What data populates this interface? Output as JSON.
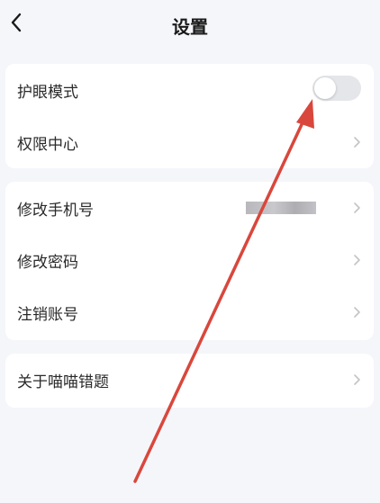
{
  "header": {
    "title": "设置",
    "back_icon": "chevron-left-icon"
  },
  "sections": [
    {
      "rows": [
        {
          "label": "护眼模式",
          "control": "toggle",
          "toggle_on": false
        },
        {
          "label": "权限中心",
          "control": "chevron"
        }
      ]
    },
    {
      "rows": [
        {
          "label": "修改手机号",
          "control": "chevron",
          "value_masked": true
        },
        {
          "label": "修改密码",
          "control": "chevron"
        },
        {
          "label": "注销账号",
          "control": "chevron"
        }
      ]
    },
    {
      "rows": [
        {
          "label": "关于喵喵错题",
          "control": "chevron"
        }
      ]
    }
  ],
  "colors": {
    "background": "#f5f6fa",
    "card": "#ffffff",
    "toggle_off": "#e5e6ea",
    "chevron": "#c4c4c8",
    "annotation_arrow": "#d9473c"
  }
}
